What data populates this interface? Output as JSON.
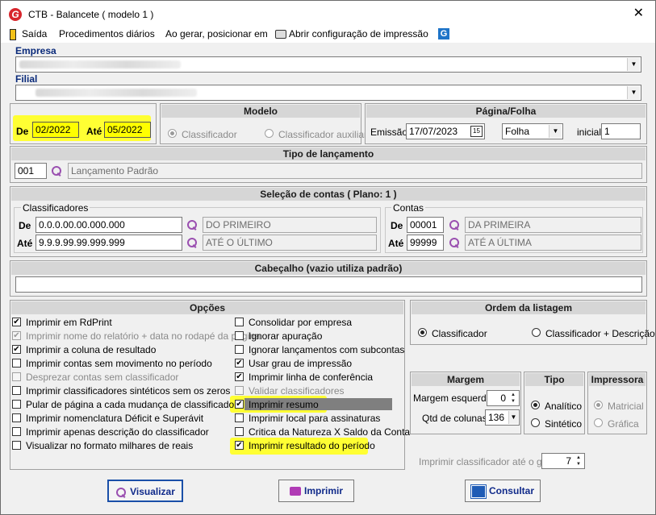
{
  "window": {
    "title": "CTB - Balancete  ( modelo 1 )",
    "close": "✕"
  },
  "menu": {
    "exit": "Saída",
    "procedures": "Procedimentos diários",
    "position": "Ao gerar, posicionar em",
    "print_config": "Abrir configuração de impressão"
  },
  "empresa": {
    "label": "Empresa"
  },
  "filial": {
    "label": "Filial"
  },
  "period": {
    "from_label": "De",
    "from": "02/2022",
    "to_label": "Até",
    "to": "05/2022"
  },
  "modelo": {
    "title": "Modelo",
    "opt1": "Classificador",
    "opt2": "Classificador auxiliar"
  },
  "pagina": {
    "title": "Página/Folha",
    "emissao_label": "Emissão",
    "emissao": "17/07/2023",
    "cal": "15",
    "folha": "Folha",
    "inicial_label": "inicial",
    "inicial": "1"
  },
  "tipo_lanc": {
    "title": "Tipo de lançamento",
    "code": "001",
    "desc": "Lançamento Padrão"
  },
  "selecao": {
    "title": "Seleção de contas  ( Plano: 1 )",
    "class_group": "Classificadores",
    "contas_group": "Contas",
    "de": "De",
    "ate": "Até",
    "class_from": "0.0.0.00.00.000.000",
    "class_from_desc": "DO PRIMEIRO",
    "class_to": "9.9.9.99.99.999.999",
    "class_to_desc": "ATÉ O ÚLTIMO",
    "conta_from": "00001",
    "conta_from_desc": "DA PRIMEIRA",
    "conta_to": "99999",
    "conta_to_desc": "ATÉ A ÚLTIMA"
  },
  "cabecalho": {
    "title": "Cabeçalho (vazio utiliza padrão)",
    "value": ""
  },
  "opcoes": {
    "title": "Opções",
    "left": [
      {
        "label": "Imprimir em RdPrint",
        "checked": true,
        "disabled": false
      },
      {
        "label": "Imprimir nome do relatório + data no rodapé da página",
        "checked": true,
        "disabled": true
      },
      {
        "label": "Imprimir a coluna de resultado",
        "checked": true,
        "disabled": false
      },
      {
        "label": "Imprimir contas sem movimento no período",
        "checked": false,
        "disabled": false
      },
      {
        "label": "Desprezar contas sem classificador",
        "checked": false,
        "disabled": true
      },
      {
        "label": "Imprimir classificadores sintéticos sem os zeros",
        "checked": false,
        "disabled": false
      },
      {
        "label": "Pular de página a cada mudança de classificador",
        "checked": false,
        "disabled": false
      },
      {
        "label": "Imprimir nomenclatura Déficit e Superávit",
        "checked": false,
        "disabled": false
      },
      {
        "label": "Imprimir apenas descrição do classificador",
        "checked": false,
        "disabled": false
      },
      {
        "label": "Visualizar no formato milhares de reais",
        "checked": false,
        "disabled": false
      }
    ],
    "right": [
      {
        "label": "Consolidar por empresa",
        "checked": false,
        "disabled": false
      },
      {
        "label": "Ignorar apuração",
        "checked": false,
        "disabled": false
      },
      {
        "label": "Ignorar lançamentos com subcontas",
        "checked": false,
        "disabled": false
      },
      {
        "label": "Usar grau de impressão",
        "checked": true,
        "disabled": false
      },
      {
        "label": "Imprimir linha de conferência",
        "checked": true,
        "disabled": false
      },
      {
        "label": "Validar classificadores",
        "checked": false,
        "disabled": true
      },
      {
        "label": "Imprimir resumo",
        "checked": true,
        "disabled": false
      },
      {
        "label": "Imprimir local para assinaturas",
        "checked": false,
        "disabled": false
      },
      {
        "label": "Critica da Natureza X Saldo da Conta",
        "checked": false,
        "disabled": false
      },
      {
        "label": "Imprimir resultado do período",
        "checked": true,
        "disabled": false
      }
    ]
  },
  "ordem": {
    "title": "Ordem da listagem",
    "opt1": "Classificador",
    "opt2": "Classificador + Descrição"
  },
  "margem": {
    "title": "Margem",
    "esq_label": "Margem esquerda",
    "esq": "0",
    "col_label": "Qtd de colunas",
    "col": "136"
  },
  "tipo": {
    "title": "Tipo",
    "opt1": "Analítico",
    "opt2": "Sintético"
  },
  "impressora": {
    "title": "Impressora",
    "opt1": "Matricial",
    "opt2": "Gráfica"
  },
  "grau": {
    "label": "Imprimir classificador até o grau",
    "value": "7"
  },
  "buttons": {
    "visualizar": "Visualizar",
    "imprimir": "Imprimir",
    "consultar": "Consultar"
  }
}
